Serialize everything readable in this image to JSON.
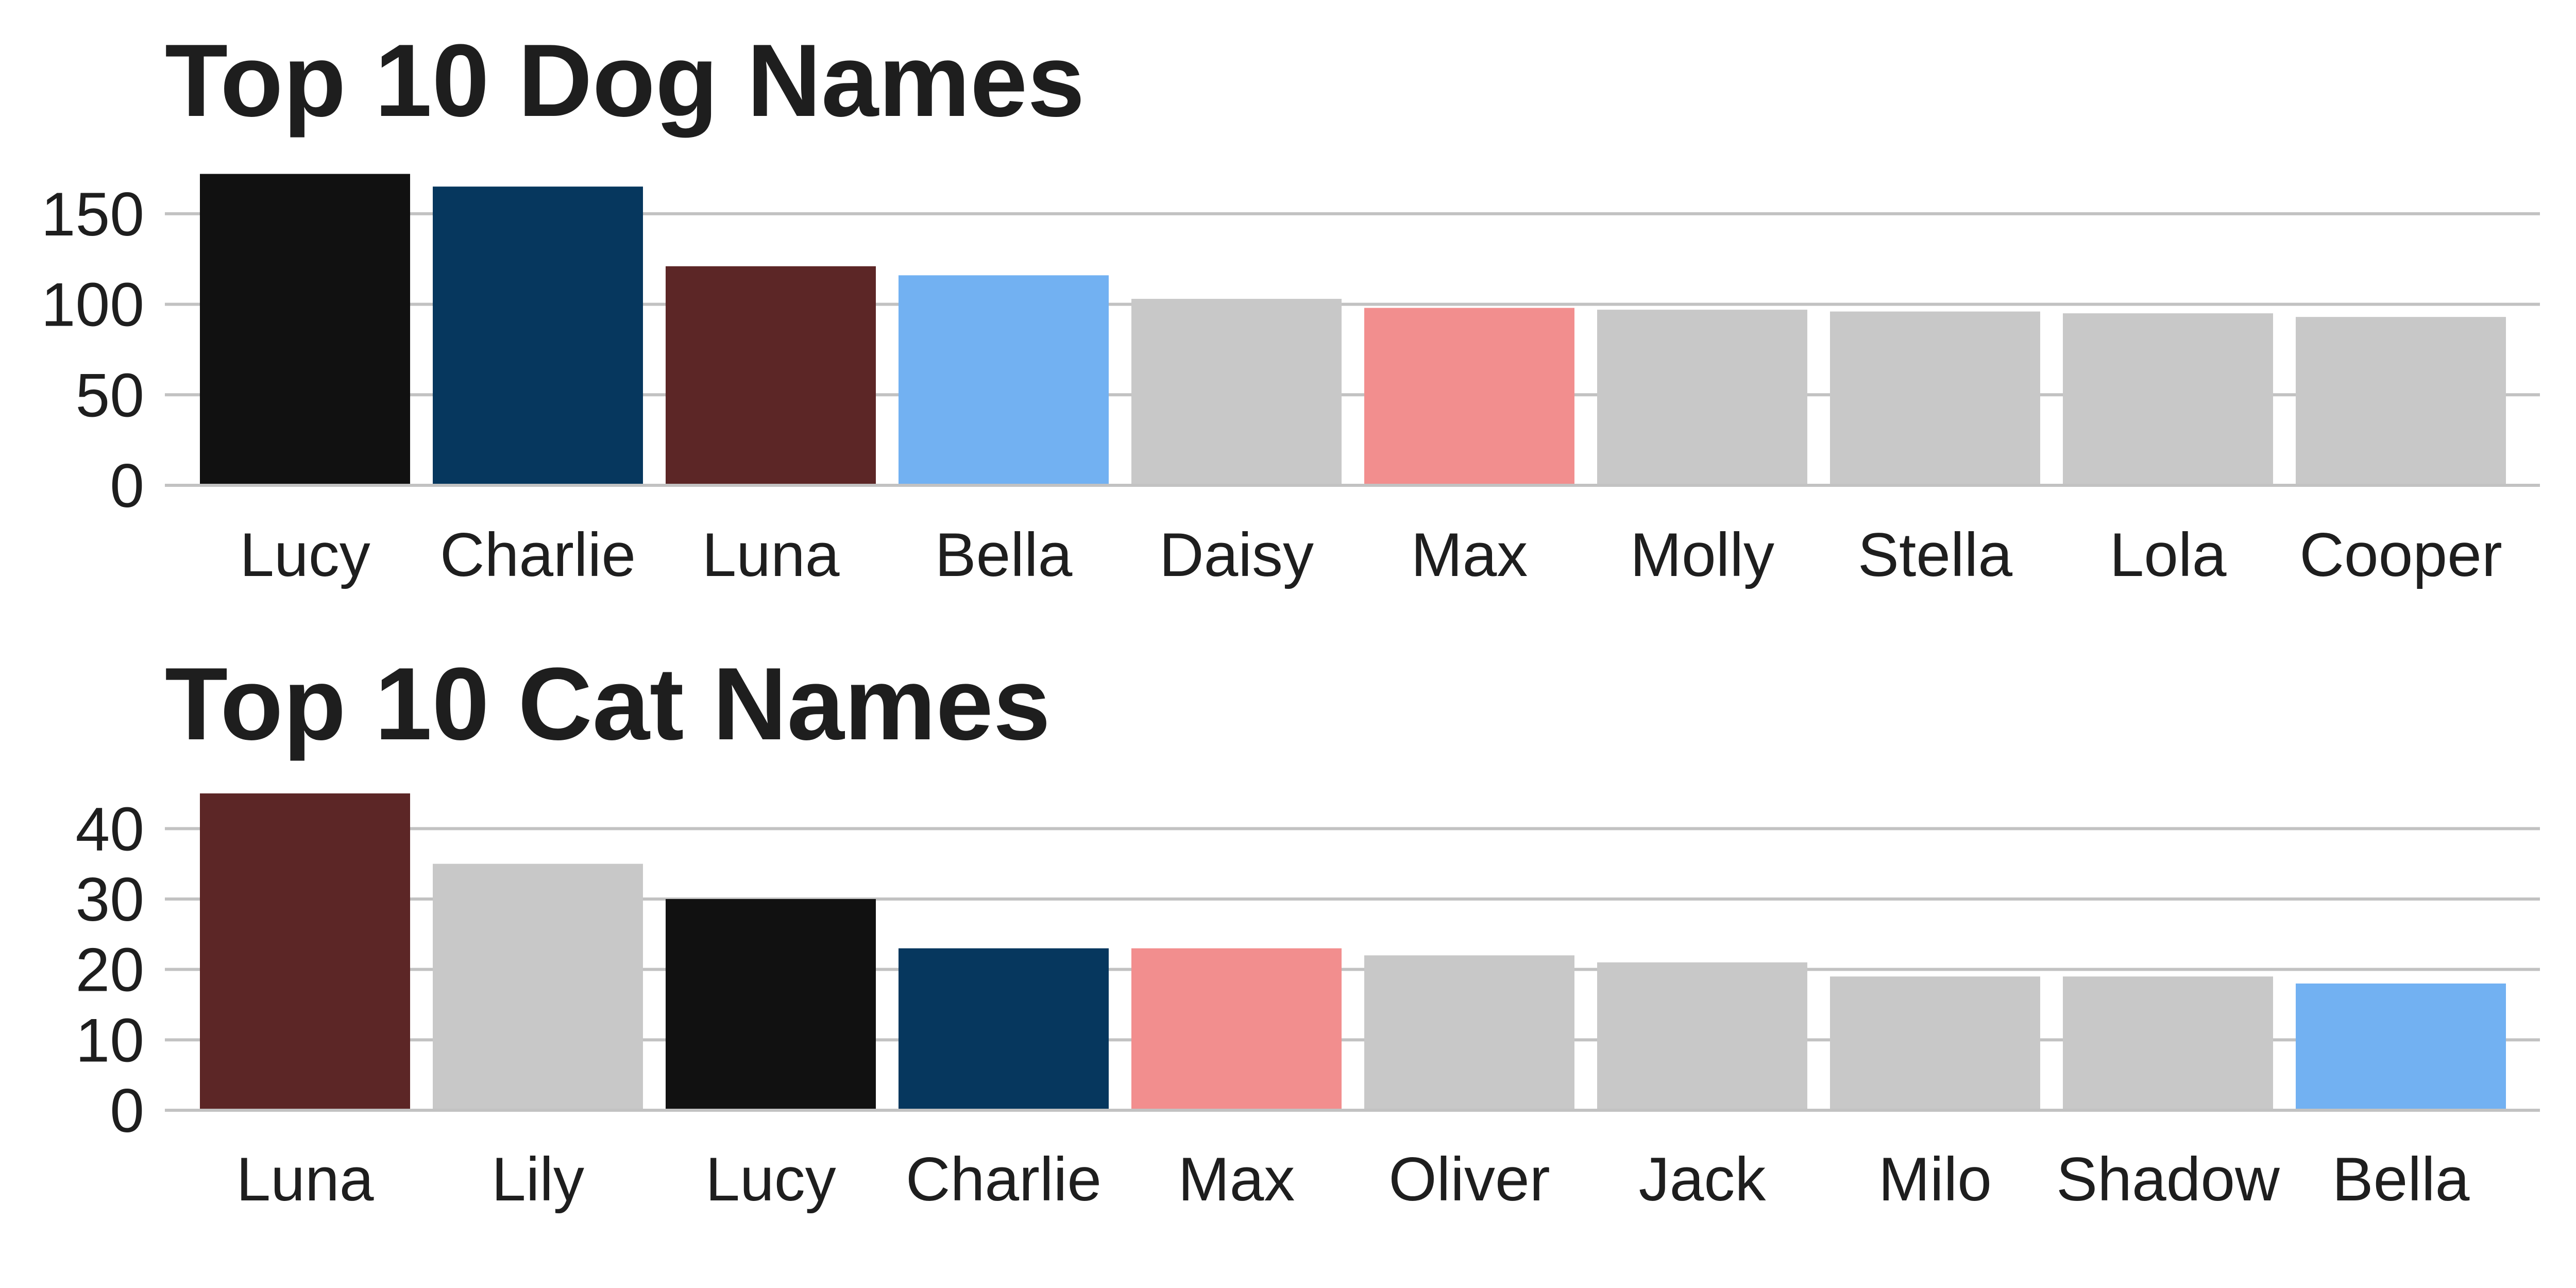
{
  "chart_data": [
    {
      "type": "bar",
      "title": "Top 10 Dog Names",
      "categories": [
        "Lucy",
        "Charlie",
        "Luna",
        "Bella",
        "Daisy",
        "Max",
        "Molly",
        "Stella",
        "Lola",
        "Cooper"
      ],
      "values": [
        172,
        165,
        121,
        116,
        103,
        98,
        97,
        96,
        95,
        93
      ],
      "colors": [
        "#111111",
        "#06375e",
        "#5c2626",
        "#72b1f2",
        "#c8c8c8",
        "#f28e8e",
        "#c8c8c8",
        "#c8c8c8",
        "#c8c8c8",
        "#c8c8c8"
      ],
      "yticks": [
        0,
        50,
        100,
        150
      ],
      "ylim": [
        0,
        175
      ],
      "grid": true,
      "xlabel": "",
      "ylabel": ""
    },
    {
      "type": "bar",
      "title": "Top 10 Cat Names",
      "categories": [
        "Luna",
        "Lily",
        "Lucy",
        "Charlie",
        "Max",
        "Oliver",
        "Jack",
        "Milo",
        "Shadow",
        "Bella"
      ],
      "values": [
        45,
        35,
        30,
        23,
        23,
        22,
        21,
        19,
        19,
        18
      ],
      "colors": [
        "#5c2626",
        "#c8c8c8",
        "#111111",
        "#06375e",
        "#f28e8e",
        "#c8c8c8",
        "#c8c8c8",
        "#c8c8c8",
        "#c8c8c8",
        "#72b1f2"
      ],
      "yticks": [
        0,
        10,
        20,
        30,
        40
      ],
      "ylim": [
        0,
        45
      ],
      "grid": true,
      "xlabel": "",
      "ylabel": ""
    }
  ]
}
